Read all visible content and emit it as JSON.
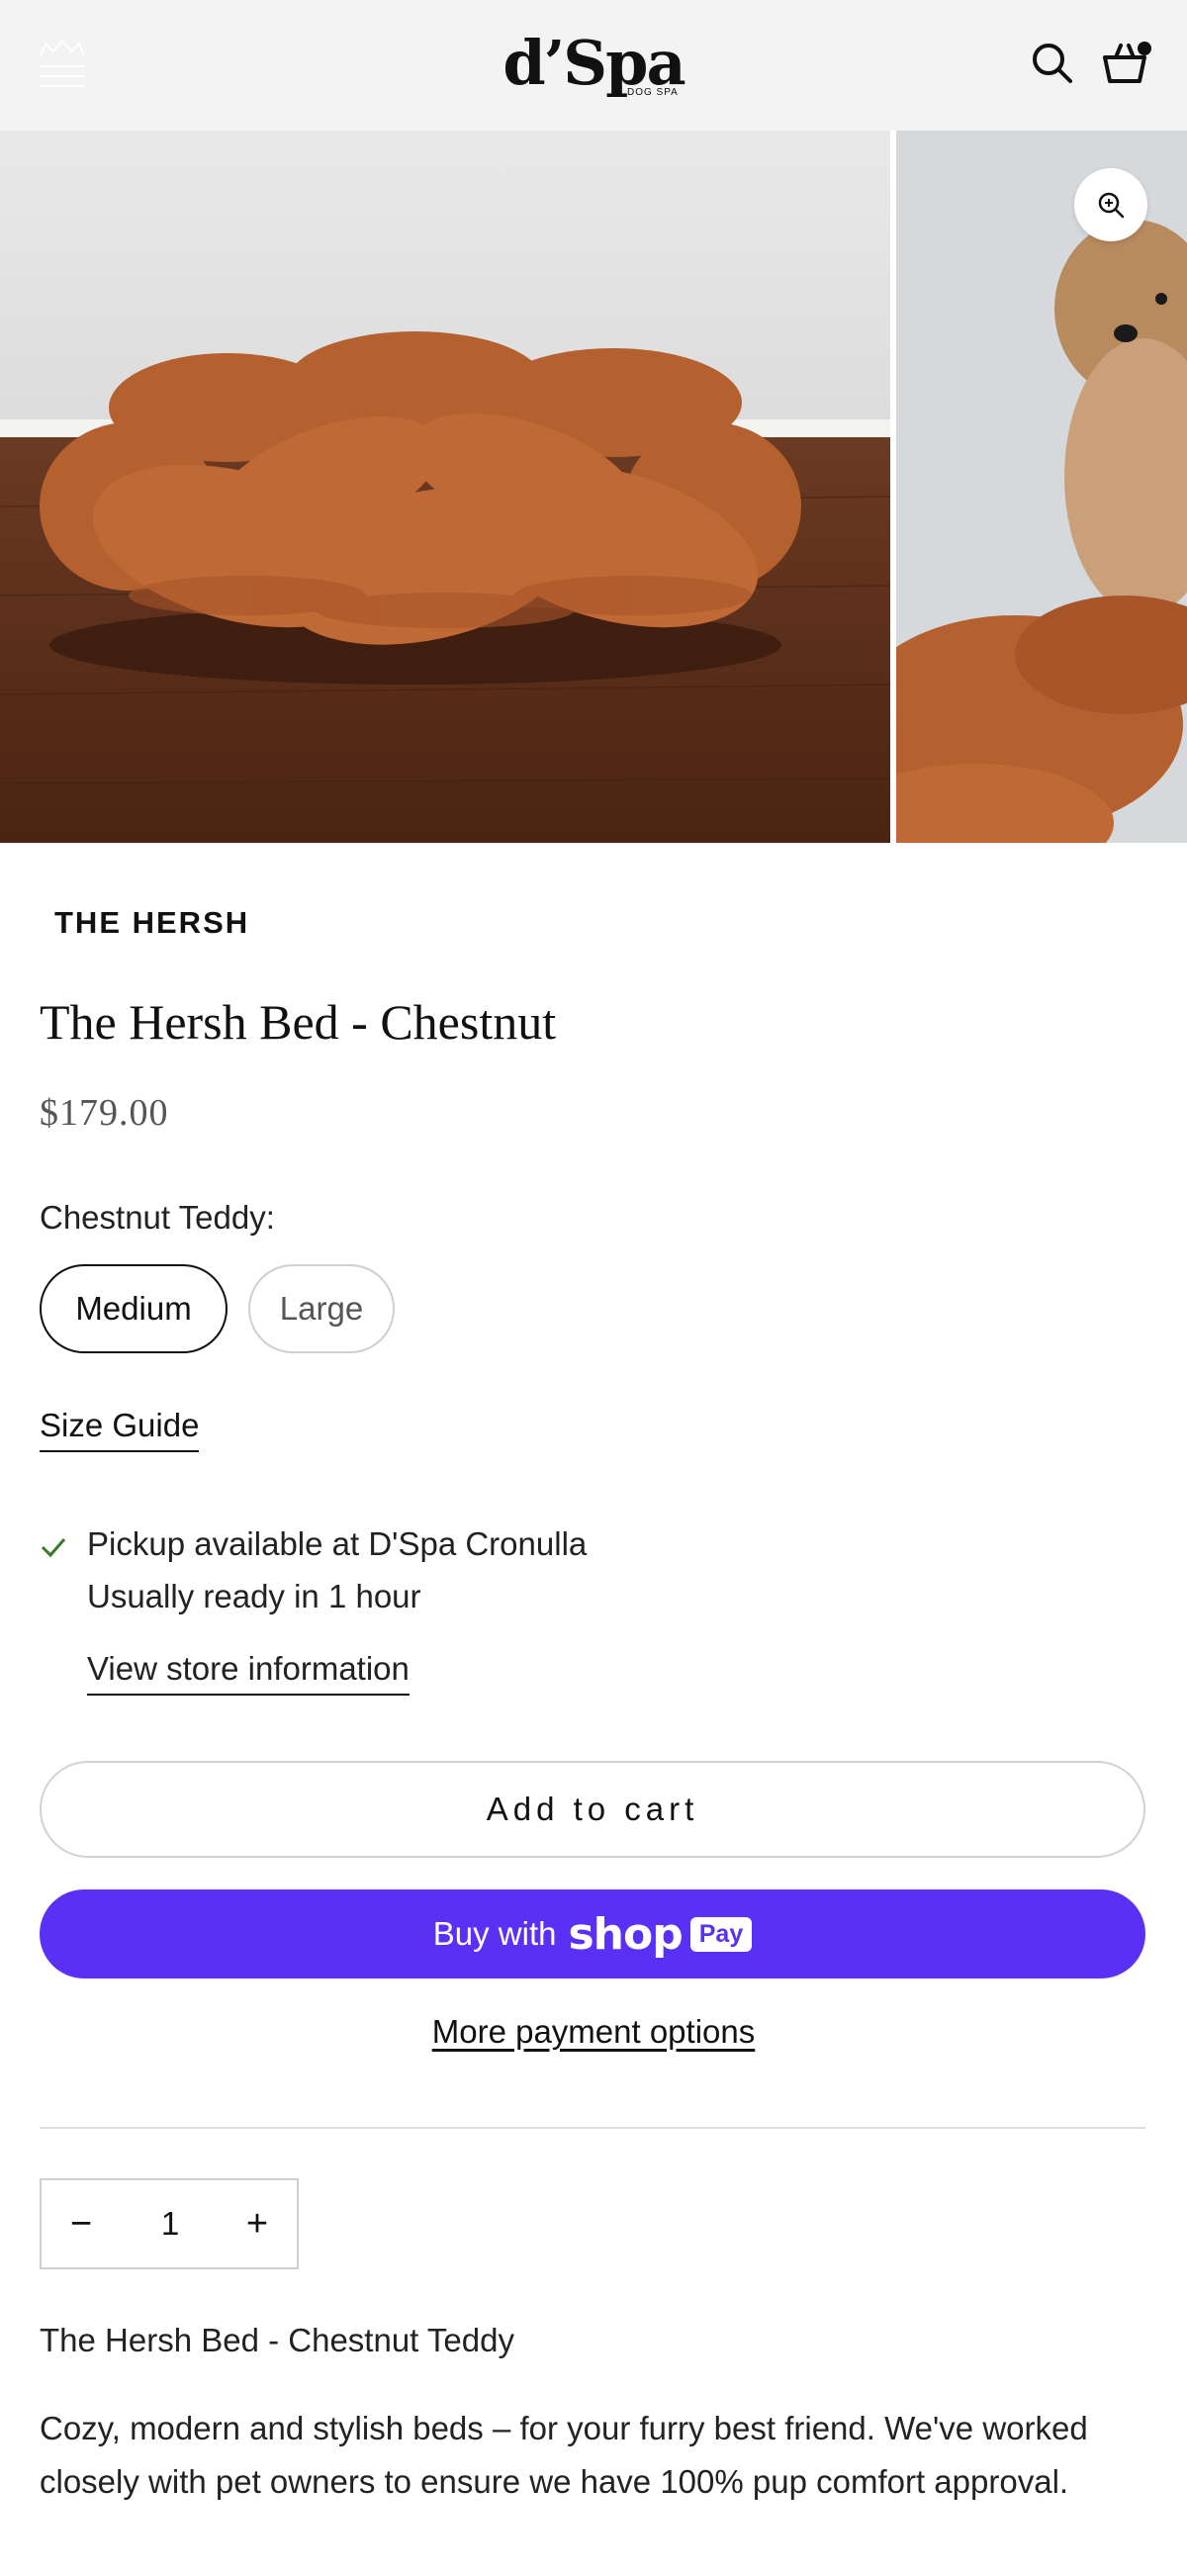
{
  "header": {
    "logo_text": "d’Spa",
    "logo_subtext": "DOG SPA",
    "menu_icon": "hamburger-crown-icon",
    "search_icon": "search-icon",
    "cart_icon": "cart-basket-icon"
  },
  "gallery": {
    "zoom_icon": "zoom-in-icon",
    "images": [
      "braided-bed-photo",
      "dog-on-bed-photo"
    ]
  },
  "product": {
    "vendor": "THE HERSH",
    "title": "The Hersh Bed - Chestnut",
    "price": "$179.00",
    "variant_label": "Chestnut Teddy:",
    "variants": [
      {
        "label": "Medium",
        "selected": true
      },
      {
        "label": "Large",
        "selected": false
      }
    ],
    "size_guide": "Size Guide"
  },
  "pickup": {
    "line1": "Pickup available at D'Spa Cronulla",
    "line2": "Usually ready in 1 hour",
    "link": "View store information"
  },
  "actions": {
    "add_to_cart": "Add to cart",
    "buy_with": "Buy with",
    "shop_word": "shop",
    "pay_badge": "Pay",
    "more_payment": "More payment options"
  },
  "quantity": {
    "minus": "−",
    "value": "1",
    "plus": "+"
  },
  "description": {
    "title": "The Hersh Bed - Chestnut Teddy",
    "body": "Cozy, modern and stylish beds – for your furry best friend. We've worked closely with pet owners to ensure we have 100% pup comfort approval."
  },
  "colors": {
    "header_bg": "#f2f3f2",
    "shop_pay": "#5a31f4",
    "text": "#1a1a1a"
  }
}
